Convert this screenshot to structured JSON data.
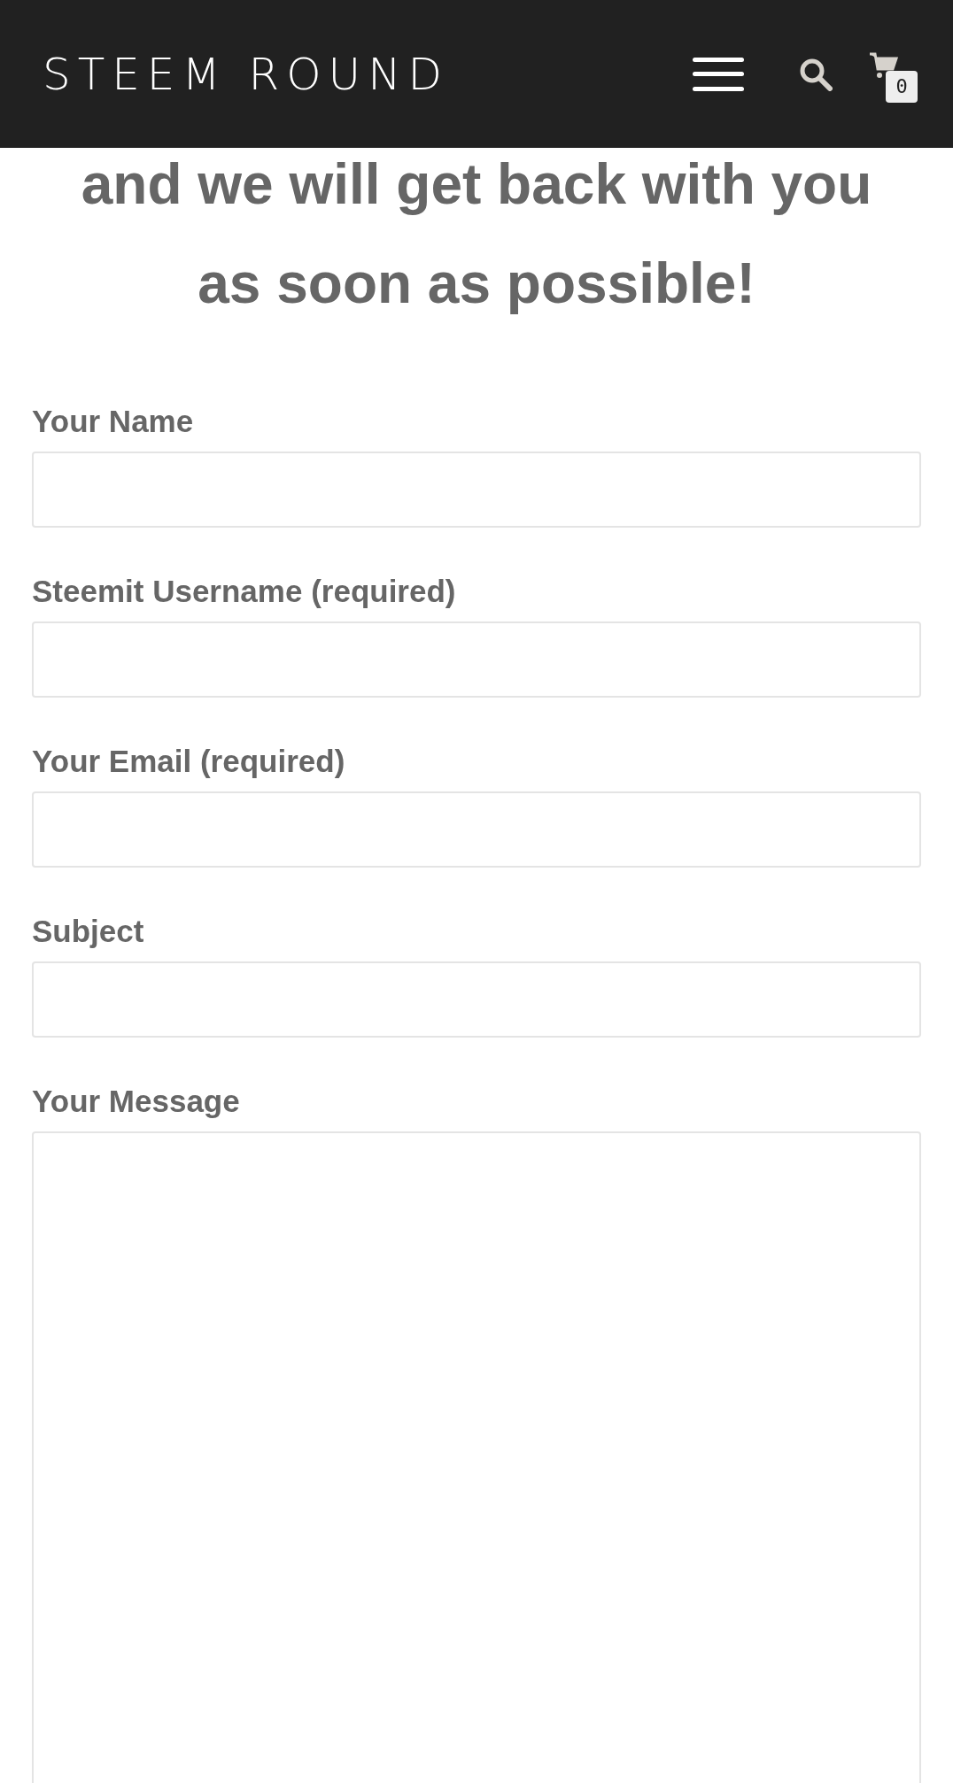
{
  "header": {
    "logo": "STEEM ROUND",
    "cart_count": "0"
  },
  "heading": [
    "and we will get back with you",
    "as soon as possible!"
  ],
  "fields": [
    {
      "label": "Your Name",
      "kind": "input"
    },
    {
      "label": "Steemit Username (required)",
      "kind": "input"
    },
    {
      "label": "Your Email (required)",
      "kind": "input"
    },
    {
      "label": "Subject",
      "kind": "input"
    },
    {
      "label": "Your Message",
      "kind": "textarea"
    }
  ]
}
